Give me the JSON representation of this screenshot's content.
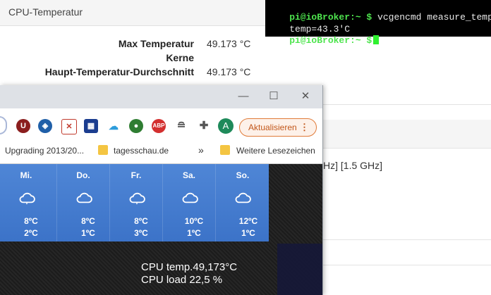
{
  "panel": {
    "title": "CPU-Temperatur",
    "rows": [
      {
        "key": "Max Temperatur",
        "value": "49.173 °C"
      },
      {
        "key": "Kerne",
        "value": ""
      },
      {
        "key": "Haupt-Temperatur-Durchschnitt",
        "value": "49.173 °C"
      }
    ],
    "freq_text": "Hz] [1.5 GHz]"
  },
  "terminal": {
    "line1_prompt": "pi@ioBroker:~ $",
    "line1_cmd": " vcgencmd measure_temp",
    "line2": "temp=43.3'C",
    "line3_prompt": "pi@ioBroker:~ $"
  },
  "browser": {
    "window_controls": {
      "minimize": "—",
      "maximize": "☐",
      "close": "✕"
    },
    "update_button": {
      "label": "Aktualisieren",
      "menu": "⋮"
    },
    "avatar_letter": "A",
    "bookmarks": [
      "Upgrading 2013/20...",
      "tagesschau.de",
      "Weitere Lesezeichen"
    ],
    "bookmarks_more": "»"
  },
  "weather": {
    "days": [
      {
        "name": "Mi.",
        "max": "8ºC",
        "min": "2ºC"
      },
      {
        "name": "Do.",
        "max": "8ºC",
        "min": "1ºC"
      },
      {
        "name": "Fr.",
        "max": "8ºC",
        "min": "3ºC"
      },
      {
        "name": "Sa.",
        "max": "10ºC",
        "min": "1ºC"
      },
      {
        "name": "So.",
        "max": "12ºC",
        "min": "1ºC"
      }
    ]
  },
  "cpu": {
    "temp": "CPU temp.49,173°C",
    "load": "CPU load 22,5 %"
  },
  "colors": {
    "accent_orange": "#e07b39",
    "weather_blue": "#4f86d6",
    "terminal_green": "#4ee44e"
  }
}
